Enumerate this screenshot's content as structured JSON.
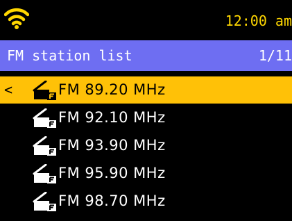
{
  "status": {
    "wifi_icon": "wifi-icon",
    "time": "12:00 am",
    "time_color": "#FFD700"
  },
  "header": {
    "title": "FM station list",
    "page": "1/11",
    "background": "#6E6EF2"
  },
  "stations": [
    {
      "label": "FM 89.20 MHz",
      "selected": true,
      "icon": "fm-radio-icon"
    },
    {
      "label": "FM 92.10 MHz",
      "selected": false,
      "icon": "fm-radio-icon"
    },
    {
      "label": "FM 93.90 MHz",
      "selected": false,
      "icon": "fm-radio-icon"
    },
    {
      "label": "FM 95.90 MHz",
      "selected": false,
      "icon": "fm-radio-icon"
    },
    {
      "label": "FM 98.70 MHz",
      "selected": false,
      "icon": "fm-radio-icon"
    }
  ],
  "back_glyph": "<",
  "selection_color": "#FFC107"
}
